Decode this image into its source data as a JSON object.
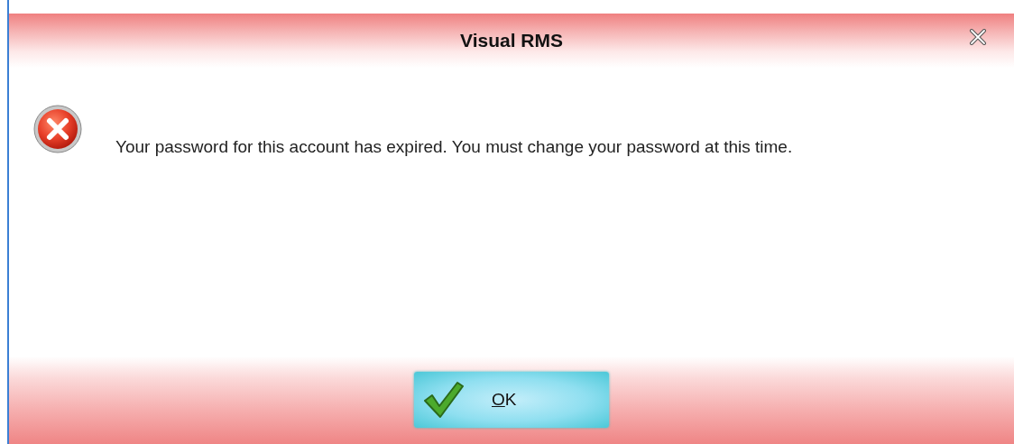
{
  "window": {
    "title": "Visual RMS"
  },
  "message": {
    "kind": "error",
    "text": "Your password for this account has expired. You must change your password at this time."
  },
  "buttons": [
    {
      "label": "OK",
      "mnemonic_underlined": true
    }
  ]
}
